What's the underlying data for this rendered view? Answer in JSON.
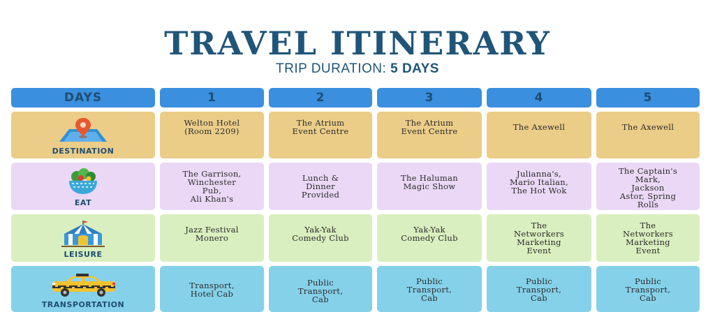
{
  "title": "TRAVEL ITINERARY",
  "subtitle": {
    "prefix": "TRIP DURATION: ",
    "value": "5 DAYS"
  },
  "header": {
    "label": "DAYS",
    "days": [
      "1",
      "2",
      "3",
      "4",
      "5"
    ]
  },
  "rows": [
    {
      "label": "DESTINATION",
      "icon": "map-pin-icon",
      "cells": [
        "Welton Hotel\n(Room 2209)",
        "The Atrium\nEvent Centre",
        "The Atrium\nEvent Centre",
        "The Axewell",
        "The Axewell"
      ]
    },
    {
      "label": "EAT",
      "icon": "salad-bowl-icon",
      "cells": [
        "The Garrison,\nWinchester\nPub,\nAli Khan's",
        "Lunch &\nDinner\nProvided",
        "The Haluman\nMagic Show",
        "Julianna's,\nMario Italian,\nThe Hot Wok",
        "The Captain's\nMark,\nJackson\nAstor, Spring\nRolls"
      ]
    },
    {
      "label": "LEISURE",
      "icon": "circus-tent-icon",
      "cells": [
        "Jazz Festival\nMonero",
        "Yak-Yak\nComedy Club",
        "Yak-Yak\nComedy Club",
        "The\nNetworkers\nMarketing\nEvent",
        "The\nNetworkers\nMarketing\nEvent"
      ]
    },
    {
      "label": "TRANSPORTATION",
      "icon": "taxi-cab-icon",
      "cells": [
        "Transport,\nHotel Cab",
        "Public\nTransport,\nCab",
        "Public\nTransport,\nCab",
        "Public\nTransport,\nCab",
        "Public\nTransport,\nCab"
      ]
    }
  ],
  "colors": {
    "title": "#1f5578",
    "header": "#3a8fde",
    "destination": "#ebcd88",
    "eat": "#ead8f6",
    "leisure": "#d9efbf",
    "transportation": "#85d1ea"
  }
}
